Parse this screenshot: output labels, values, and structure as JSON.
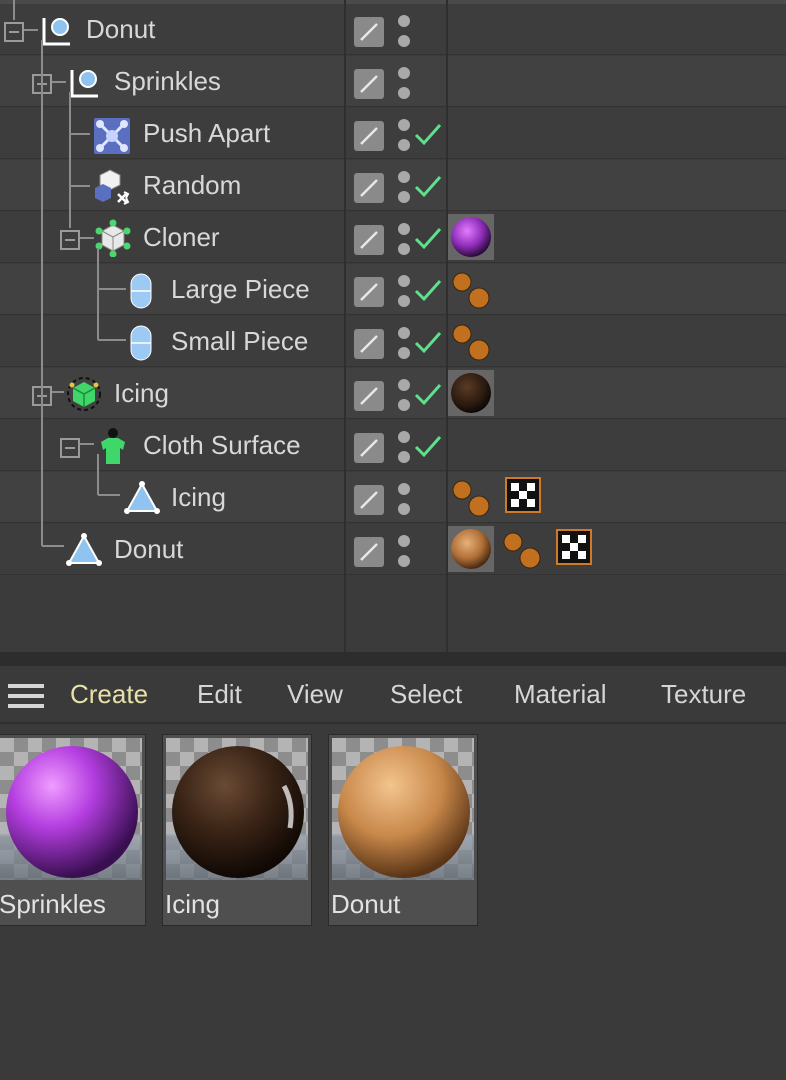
{
  "object_manager": {
    "rows": [
      {
        "label": "Donut",
        "icon": "null-object-icon",
        "enabled": false,
        "tags": []
      },
      {
        "label": "Sprinkles",
        "icon": "null-object-icon",
        "enabled": false,
        "tags": []
      },
      {
        "label": "Push Apart",
        "icon": "push-apart-effector-icon",
        "enabled": true,
        "tags": []
      },
      {
        "label": "Random",
        "icon": "random-effector-icon",
        "enabled": true,
        "tags": []
      },
      {
        "label": "Cloner",
        "icon": "cloner-icon",
        "enabled": true,
        "tags": [
          "sprinkles-material-tag"
        ]
      },
      {
        "label": "Large Piece",
        "icon": "capsule-icon",
        "enabled": true,
        "tags": [
          "phong-tag"
        ]
      },
      {
        "label": "Small Piece",
        "icon": "capsule-icon",
        "enabled": true,
        "tags": [
          "phong-tag"
        ]
      },
      {
        "label": "Icing",
        "icon": "cloth-icon",
        "enabled": true,
        "tags": [
          "icing-material-tag"
        ]
      },
      {
        "label": "Cloth Surface",
        "icon": "cloth-surface-icon",
        "enabled": true,
        "tags": []
      },
      {
        "label": "Icing",
        "icon": "polygon-object-icon",
        "enabled": false,
        "tags": [
          "phong-tag",
          "uvw-tag"
        ]
      },
      {
        "label": "Donut",
        "icon": "polygon-object-icon",
        "enabled": false,
        "tags": [
          "donut-material-tag",
          "phong-tag",
          "uvw-tag"
        ]
      }
    ]
  },
  "menu": {
    "items": [
      "Create",
      "Edit",
      "View",
      "Select",
      "Material",
      "Texture"
    ],
    "active": "Create"
  },
  "materials": [
    {
      "label": "Sprinkles",
      "color": "#b43ee0"
    },
    {
      "label": "Icing",
      "color": "#3a2416"
    },
    {
      "label": "Donut",
      "color": "#c8884a"
    }
  ],
  "colors": {
    "check": "#5fe08a",
    "background": "#3a3a3a",
    "menu_active": "#e7e0a8"
  }
}
